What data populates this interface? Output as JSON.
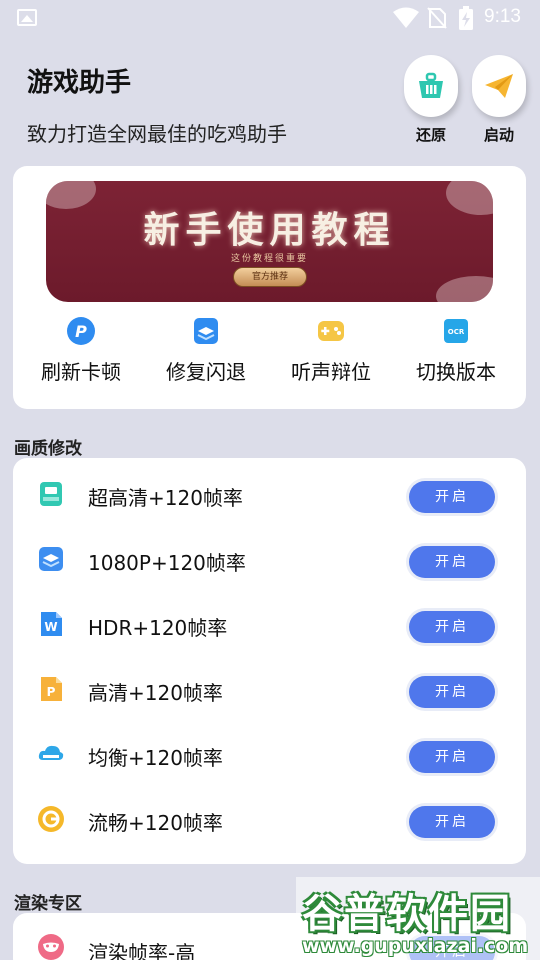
{
  "status_bar": {
    "time": "9:13"
  },
  "header": {
    "title": "游戏助手",
    "subtitle": "致力打造全网最佳的吃鸡助手",
    "restore_label": "还原",
    "launch_label": "启动"
  },
  "banner": {
    "title": "新手使用教程",
    "subtitle": "这份教程很重要",
    "button_label": "官方推荐"
  },
  "quick_actions": [
    {
      "label": "刷新卡顿",
      "icon": "p-circle-icon",
      "color": "#2f8cf0"
    },
    {
      "label": "修复闪退",
      "icon": "layers-icon",
      "color": "#2f8cf0"
    },
    {
      "label": "听声辩位",
      "icon": "gamepad-icon",
      "color": "#f5c645"
    },
    {
      "label": "切换版本",
      "icon": "ocr-icon",
      "color": "#26a6e8"
    }
  ],
  "quality_section": {
    "label": "画质修改",
    "items": [
      {
        "label": "超高清+120帧率",
        "button": "开启",
        "icon": "tray-icon",
        "color": "#31c8b2"
      },
      {
        "label": "1080P+120帧率",
        "button": "开启",
        "icon": "layers-icon",
        "color": "#3d8ef0"
      },
      {
        "label": "HDR+120帧率",
        "button": "开启",
        "icon": "word-doc-icon",
        "color": "#2f8cf0"
      },
      {
        "label": "高清+120帧率",
        "button": "开启",
        "icon": "ppt-doc-icon",
        "color": "#f7b13a"
      },
      {
        "label": "均衡+120帧率",
        "button": "开启",
        "icon": "cloud-icon",
        "color": "#2ea7e8"
      },
      {
        "label": "流畅+120帧率",
        "button": "开启",
        "icon": "g-circle-icon",
        "color": "#f5b82a"
      }
    ]
  },
  "render_section": {
    "label": "渲染专区",
    "items": [
      {
        "label": "渲染帧率-高",
        "button": "开启",
        "icon": "mask-icon",
        "color": "#ef6a86"
      }
    ]
  },
  "watermark": {
    "text": "谷普软件园",
    "url": "www.gupuxiazai.com"
  },
  "colors": {
    "background": "#dcdde9",
    "card": "#ffffff",
    "toggle": "#4f77ec",
    "banner": "#7d2335"
  }
}
